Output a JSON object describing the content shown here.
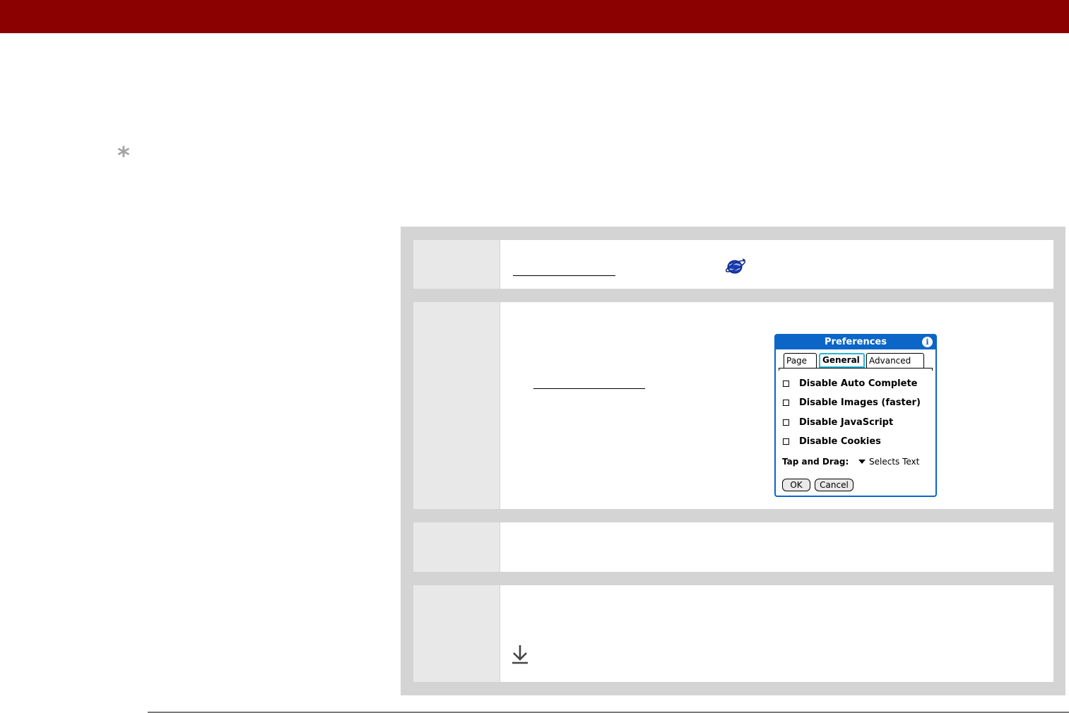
{
  "header": {
    "color": "#8b0000"
  },
  "tip": {
    "icon": "asterisk-icon",
    "glyph": "*"
  },
  "steps": {
    "step1": {
      "icons": [
        "web-browser-icon"
      ]
    },
    "step2": {
      "dialog": {
        "title": "Preferences",
        "info_glyph": "i",
        "tabs": [
          {
            "label": "Page"
          },
          {
            "label": "General",
            "selected": true
          },
          {
            "label": "Advanced"
          }
        ],
        "options": [
          {
            "label": "Disable Auto Complete",
            "checked": false
          },
          {
            "label": "Disable Images (faster)",
            "checked": false
          },
          {
            "label": "Disable JavaScript",
            "checked": false
          },
          {
            "label": "Disable Cookies",
            "checked": false
          }
        ],
        "tap_and_drag": {
          "label": "Tap and Drag:",
          "value": "Selects Text"
        },
        "buttons": {
          "ok": "OK",
          "cancel": "Cancel"
        }
      }
    },
    "step3": {},
    "step4": {
      "icons": [
        "download-arrow-icon"
      ]
    }
  }
}
